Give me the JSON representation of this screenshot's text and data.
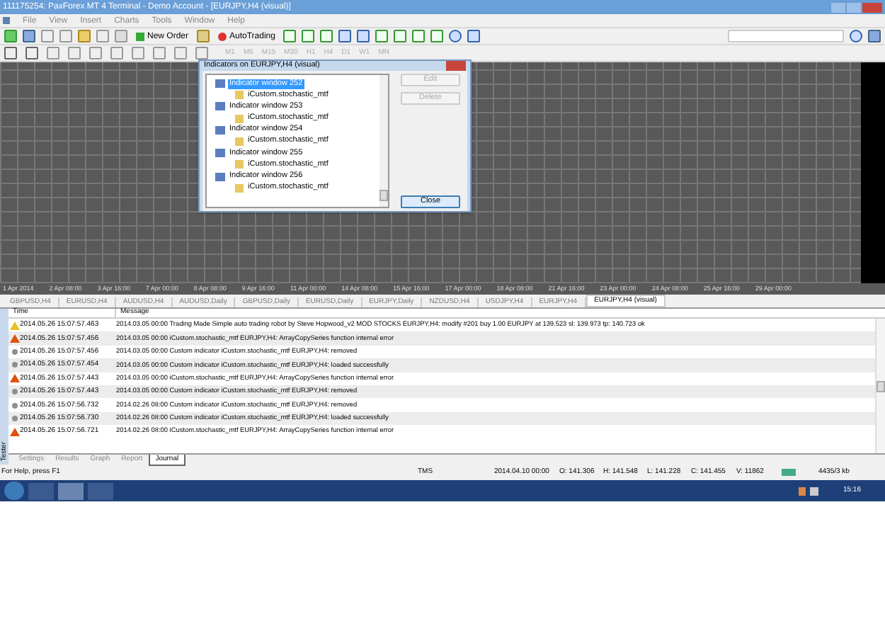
{
  "window": {
    "title": "111175254: PaxForex MT 4 Terminal - Demo Account - [EURJPY,H4 (visual)]"
  },
  "menu": [
    "File",
    "View",
    "Insert",
    "Charts",
    "Tools",
    "Window",
    "Help"
  ],
  "toolbar": {
    "new_order": "New Order",
    "auto_trading": "AutoTrading"
  },
  "timeframes": [
    "M1",
    "M5",
    "M15",
    "M30",
    "H1",
    "H4",
    "D1",
    "W1",
    "MN"
  ],
  "dialog": {
    "title": "Indicators on EURJPY,H4 (visual)",
    "tree": [
      {
        "label": "Indicator window 252",
        "selected": true,
        "children": [
          {
            "label": "iCustom.stochastic_mtf",
            "selected": false
          }
        ]
      },
      {
        "label": "Indicator window 253",
        "selected": false,
        "children": [
          {
            "label": "iCustom.stochastic_mtf",
            "selected": false
          }
        ]
      },
      {
        "label": "Indicator window 254",
        "selected": false,
        "children": [
          {
            "label": "iCustom.stochastic_mtf",
            "selected": false
          }
        ]
      },
      {
        "label": "Indicator window 255",
        "selected": false,
        "children": [
          {
            "label": "iCustom.stochastic_mtf",
            "selected": false
          }
        ]
      },
      {
        "label": "Indicator window 256",
        "selected": false,
        "children": [
          {
            "label": "iCustom.stochastic_mtf",
            "selected": false
          }
        ]
      }
    ],
    "buttons": [
      {
        "label": "Edit",
        "disabled": true
      },
      {
        "label": "Delete",
        "disabled": true
      },
      {
        "label": "Close",
        "disabled": false
      }
    ]
  },
  "time_axis": [
    "1 Apr 2014",
    "2 Apr 08:00",
    "3 Apr 16:00",
    "7 Apr 00:00",
    "8 Apr 08:00",
    "9 Apr 16:00",
    "11 Apr 00:00",
    "14 Apr 08:00",
    "15 Apr 16:00",
    "17 Apr 00:00",
    "18 Apr 08:00",
    "21 Apr 16:00",
    "23 Apr 00:00",
    "24 Apr 08:00",
    "25 Apr 16:00",
    "29 Apr 00:00"
  ],
  "chart_tabs": [
    {
      "label": "GBPUSD,H4",
      "selected": false
    },
    {
      "label": "EURUSD,H4",
      "selected": false
    },
    {
      "label": "AUDUSD,H4",
      "selected": false
    },
    {
      "label": "AUDUSD,Daily",
      "selected": false
    },
    {
      "label": "GBPUSD,Daily",
      "selected": false
    },
    {
      "label": "EURUSD,Daily",
      "selected": false
    },
    {
      "label": "EURJPY,Daily",
      "selected": false
    },
    {
      "label": "NZDUSD,H4",
      "selected": false
    },
    {
      "label": "USDJPY,H4",
      "selected": false
    },
    {
      "label": "EURJPY,H4",
      "selected": false
    },
    {
      "label": "EURJPY,H4 (visual)",
      "selected": true
    }
  ],
  "log": {
    "columns": [
      "Time",
      "Message"
    ],
    "rows": [
      {
        "kind": "warning",
        "time": "2014.05.26 15:07:57.463",
        "message": "2014.03.05 00:00  Trading Made Simple auto trading robot by Steve Hopwood_v2 MOD STOCKS EURJPY,H4: modify #201 buy 1.00 EURJPY at 139.523 sl: 139.973 tp: 140.723 ok"
      },
      {
        "kind": "error",
        "time": "2014.05.26 15:07:57.456",
        "message": "2014.03.05 00:00  iCustom.stochastic_mtf EURJPY,H4: ArrayCopySeries function internal error"
      },
      {
        "kind": "info",
        "time": "2014.05.26 15:07:57.456",
        "message": "2014.03.05 00:00  Custom indicator iCustom.stochastic_mtf EURJPY,H4: removed"
      },
      {
        "kind": "info",
        "time": "2014.05.26 15:07:57.454",
        "message": "2014.03.05 00:00  Custom indicator iCustom.stochastic_mtf EURJPY,H4: loaded successfully"
      },
      {
        "kind": "error",
        "time": "2014.05.26 15:07:57.443",
        "message": "2014.03.05 00:00  iCustom.stochastic_mtf EURJPY,H4: ArrayCopySeries function internal error"
      },
      {
        "kind": "info",
        "time": "2014.05.26 15:07:57.443",
        "message": "2014.03.05 00:00  Custom indicator iCustom.stochastic_mtf EURJPY,H4: removed"
      },
      {
        "kind": "info",
        "time": "2014.05.26 15:07:56.732",
        "message": "2014.02.26 08:00  Custom indicator iCustom.stochastic_mtf EURJPY,H4: removed"
      },
      {
        "kind": "info",
        "time": "2014.05.26 15:07:56.730",
        "message": "2014.02.26 08:00  Custom indicator iCustom.stochastic_mtf EURJPY,H4: loaded successfully"
      },
      {
        "kind": "error",
        "time": "2014.05.26 15:07:56.721",
        "message": "2014.02.26 08:00  iCustom.stochastic_mtf EURJPY,H4: ArrayCopySeries function internal error"
      }
    ]
  },
  "tester_label": "Tester",
  "tester_tabs": [
    {
      "label": "Settings",
      "selected": false
    },
    {
      "label": "Results",
      "selected": false
    },
    {
      "label": "Graph",
      "selected": false
    },
    {
      "label": "Report",
      "selected": false
    },
    {
      "label": "Journal",
      "selected": true
    }
  ],
  "status_bar": {
    "help": "For Help, press F1",
    "profile": "TMS",
    "date": "2014.04.10 00:00",
    "open": "O: 141.306",
    "high": "H: 141.548",
    "low": "L: 141.228",
    "close": "C: 141.455",
    "volume": "V: 11862",
    "traffic": "4435/3 kb"
  },
  "taskbar": {
    "clock": "15:16"
  }
}
